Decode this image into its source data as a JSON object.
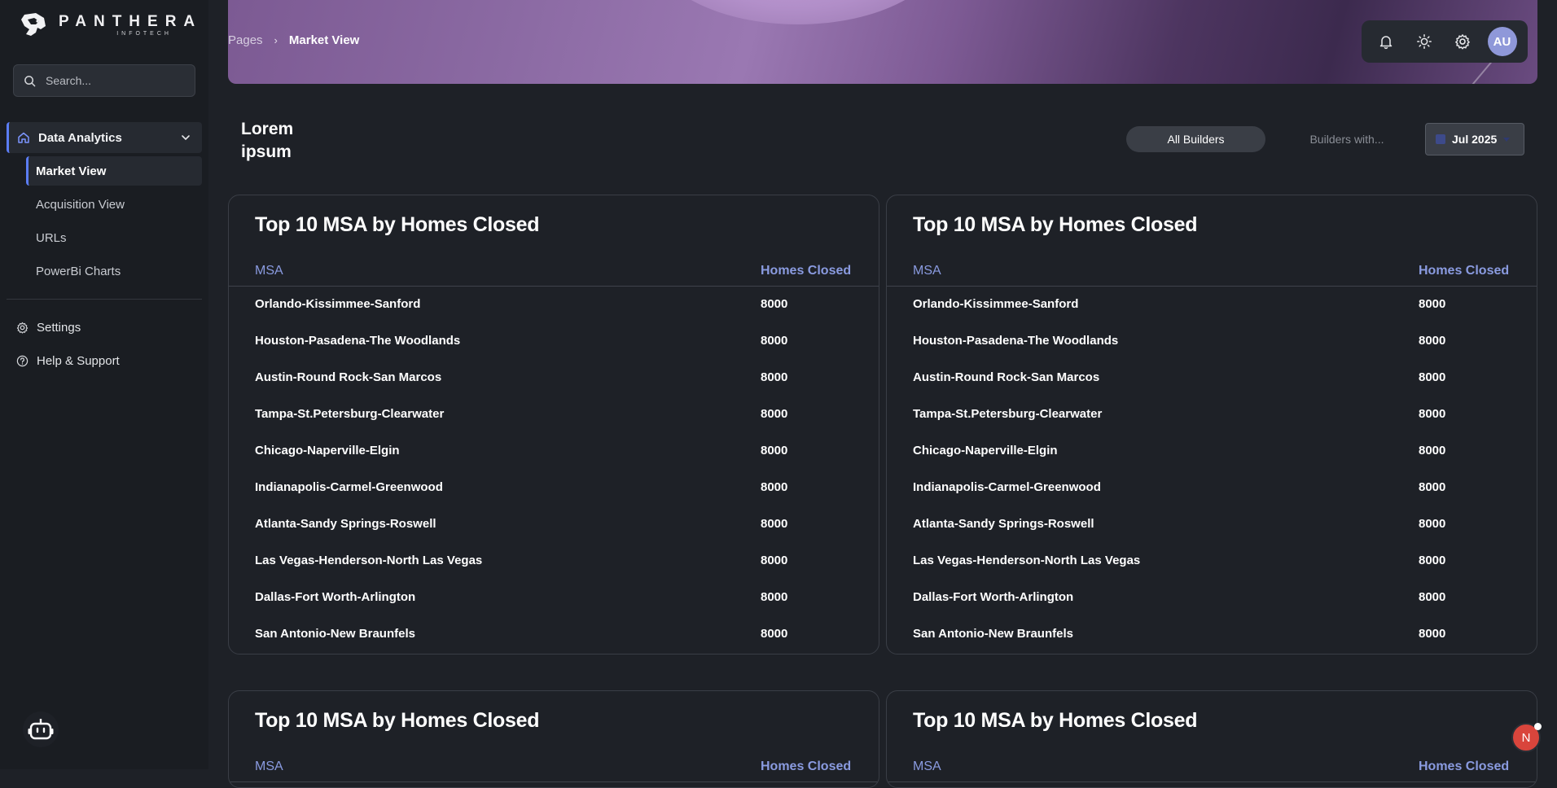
{
  "brand": {
    "name": "PANTHERA",
    "sub": "INFOTECH"
  },
  "search": {
    "placeholder": "Search..."
  },
  "sidebar": {
    "group": {
      "label": "Data Analytics",
      "icon": "home-icon"
    },
    "items": [
      {
        "label": "Market View",
        "active": true
      },
      {
        "label": "Acquisition View",
        "active": false
      },
      {
        "label": "URLs",
        "active": false
      },
      {
        "label": "PowerBi Charts",
        "active": false
      }
    ],
    "settings": "Settings",
    "help": "Help & Support"
  },
  "breadcrumb": {
    "root": "Pages",
    "current": "Market View"
  },
  "header": {
    "avatar": "AU"
  },
  "page": {
    "title": "Lorem ipsum"
  },
  "filters": {
    "all_builders": "All Builders",
    "builders_with": "Builders with...",
    "date": "Jul 2025"
  },
  "tables": [
    {
      "title": "Top 10 MSA by Homes Closed",
      "col_msa": "MSA",
      "col_hc": "Homes Closed",
      "rows": [
        {
          "msa": "Orlando-Kissimmee-Sanford",
          "hc": "8000"
        },
        {
          "msa": "Houston-Pasadena-The Woodlands",
          "hc": "8000"
        },
        {
          "msa": "Austin-Round Rock-San Marcos",
          "hc": "8000"
        },
        {
          "msa": "Tampa-St.Petersburg-Clearwater",
          "hc": "8000"
        },
        {
          "msa": "Chicago-Naperville-Elgin",
          "hc": "8000"
        },
        {
          "msa": "Indianapolis-Carmel-Greenwood",
          "hc": "8000"
        },
        {
          "msa": "Atlanta-Sandy Springs-Roswell",
          "hc": "8000"
        },
        {
          "msa": "Las Vegas-Henderson-North Las Vegas",
          "hc": "8000"
        },
        {
          "msa": "Dallas-Fort Worth-Arlington",
          "hc": "8000"
        },
        {
          "msa": "San Antonio-New Braunfels",
          "hc": "8000"
        }
      ]
    },
    {
      "title": "Top 10 MSA by Homes Closed",
      "col_msa": "MSA",
      "col_hc": "Homes Closed",
      "rows": [
        {
          "msa": "Orlando-Kissimmee-Sanford",
          "hc": "8000"
        },
        {
          "msa": "Houston-Pasadena-The Woodlands",
          "hc": "8000"
        },
        {
          "msa": "Austin-Round Rock-San Marcos",
          "hc": "8000"
        },
        {
          "msa": "Tampa-St.Petersburg-Clearwater",
          "hc": "8000"
        },
        {
          "msa": "Chicago-Naperville-Elgin",
          "hc": "8000"
        },
        {
          "msa": "Indianapolis-Carmel-Greenwood",
          "hc": "8000"
        },
        {
          "msa": "Atlanta-Sandy Springs-Roswell",
          "hc": "8000"
        },
        {
          "msa": "Las Vegas-Henderson-North Las Vegas",
          "hc": "8000"
        },
        {
          "msa": "Dallas-Fort Worth-Arlington",
          "hc": "8000"
        },
        {
          "msa": "San Antonio-New Braunfels",
          "hc": "8000"
        }
      ]
    },
    {
      "title": "Top 10 MSA by Homes Closed",
      "col_msa": "MSA",
      "col_hc": "Homes Closed"
    },
    {
      "title": "Top 10 MSA by Homes Closed",
      "col_msa": "MSA",
      "col_hc": "Homes Closed"
    }
  ],
  "notification": {
    "letter": "N"
  }
}
